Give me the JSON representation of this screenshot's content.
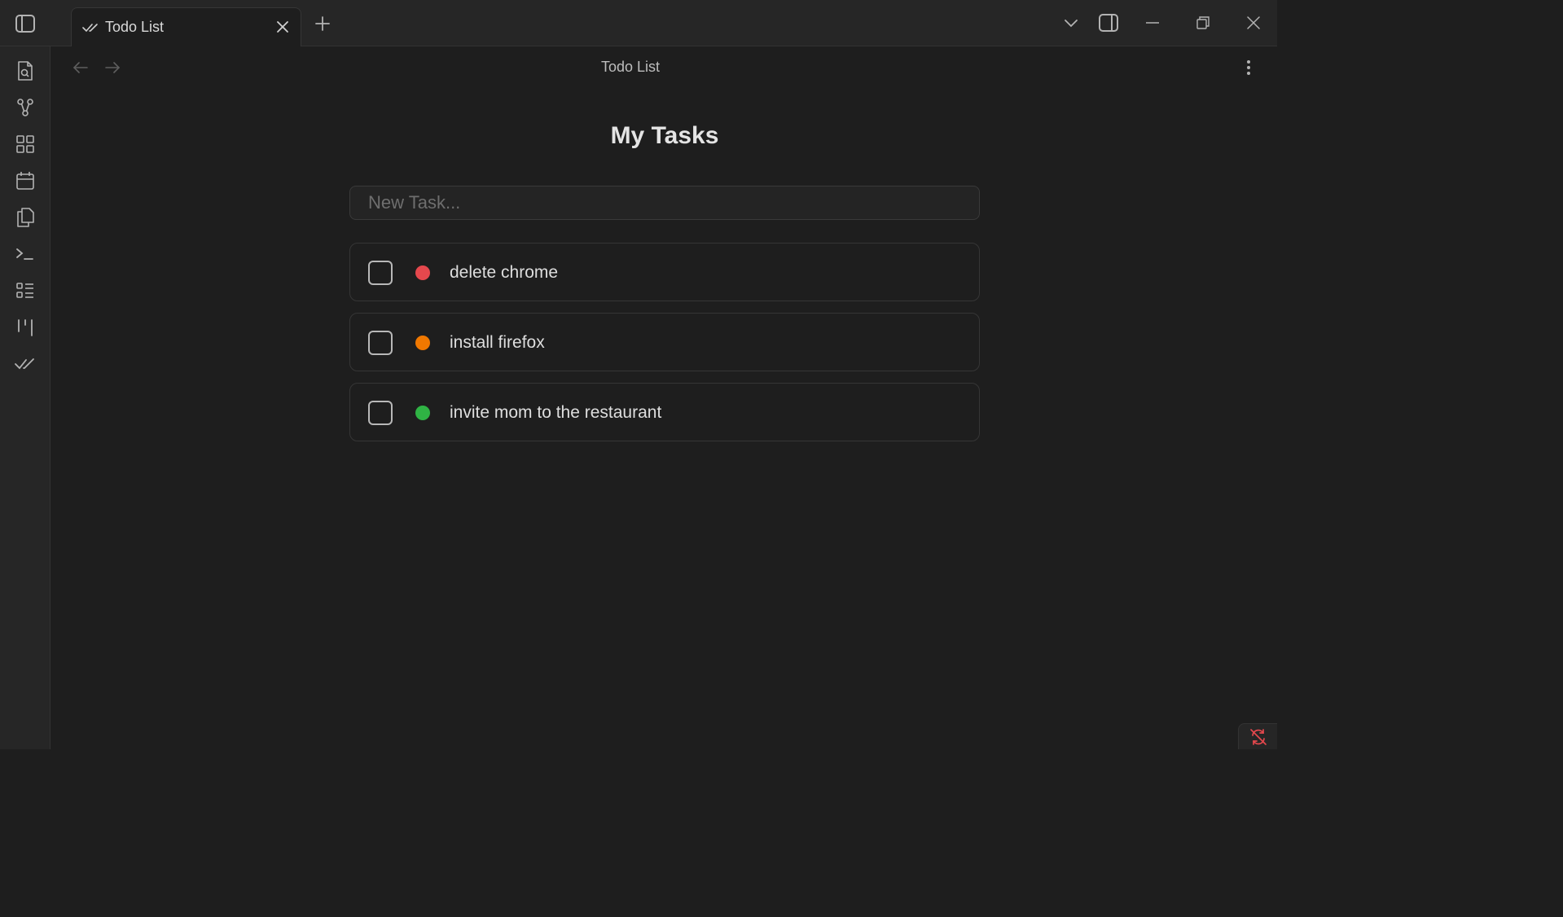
{
  "tab": {
    "title": "Todo List"
  },
  "view": {
    "title": "Todo List"
  },
  "page": {
    "title": "My Tasks",
    "new_task_placeholder": "New Task..."
  },
  "tasks": [
    {
      "label": "delete chrome",
      "priority_color": "#e5484d"
    },
    {
      "label": "install firefox",
      "priority_color": "#f07800"
    },
    {
      "label": "invite mom to the restaurant",
      "priority_color": "#2fb344"
    }
  ],
  "ribbon": {
    "icons": [
      "search-file-icon",
      "graph-icon",
      "apps-grid-icon",
      "calendar-icon",
      "copy-files-icon",
      "terminal-icon",
      "list-icon",
      "kanban-icon",
      "check-double-icon"
    ]
  },
  "colors": {
    "background": "#1e1e1e",
    "chrome": "#262626",
    "sync_error": "#e5484d"
  }
}
